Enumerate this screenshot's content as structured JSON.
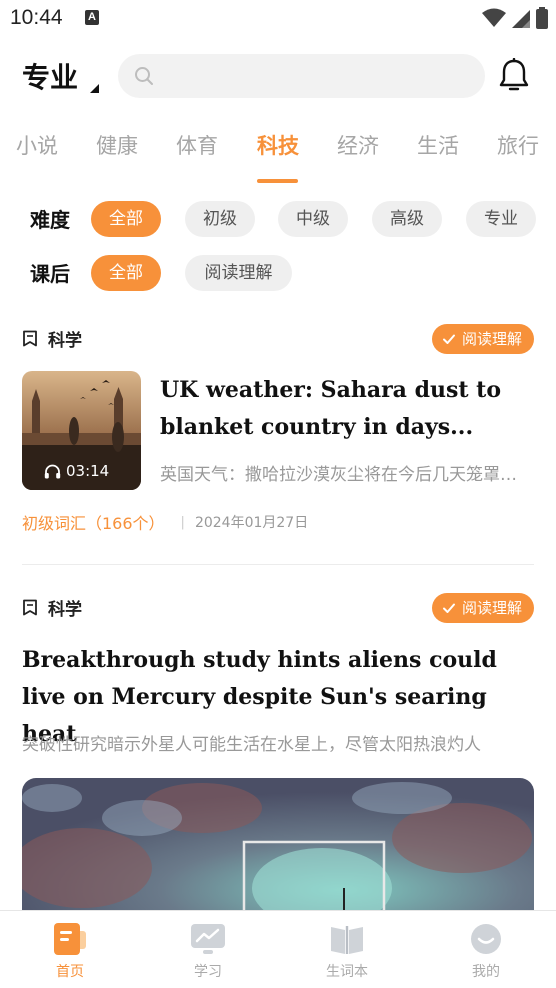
{
  "status_bar": {
    "time": "10:44",
    "app_icon_letter": "A"
  },
  "header": {
    "level": "专业",
    "search": {
      "placeholder": ""
    }
  },
  "categories": {
    "items": [
      "小说",
      "健康",
      "体育",
      "科技",
      "经济",
      "生活",
      "旅行"
    ],
    "active": "科技"
  },
  "filters": {
    "difficulty": {
      "label": "难度",
      "options": [
        "全部",
        "初级",
        "中级",
        "高级",
        "专业"
      ],
      "selected": "全部"
    },
    "after_class": {
      "label": "课后",
      "options": [
        "全部",
        "阅读理解"
      ],
      "selected": "全部"
    }
  },
  "articles": [
    {
      "tag": "科学",
      "badge": "阅读理解",
      "title": "UK weather: Sahara dust to blanket country in days...",
      "subtitle": "英国天气：撒哈拉沙漠灰尘将在今后几天笼罩全国",
      "duration": "03:14",
      "vocab": "初级词汇（166个）",
      "separator": "|",
      "date": "2024年01月27日"
    },
    {
      "tag": "科学",
      "badge": "阅读理解",
      "title": "Breakthrough study hints aliens could live on Mercury despite Sun's searing heat",
      "subtitle": "突破性研究暗示外星人可能生活在水星上，尽管太阳热浪灼人"
    }
  ],
  "bottom_nav": {
    "items": [
      {
        "label": "首页",
        "icon": "home-book-icon",
        "active": true
      },
      {
        "label": "学习",
        "icon": "study-chart-icon",
        "active": false
      },
      {
        "label": "生词本",
        "icon": "vocab-book-icon",
        "active": false
      },
      {
        "label": "我的",
        "icon": "profile-face-icon",
        "active": false
      }
    ]
  },
  "colors": {
    "accent": "#f7913a",
    "chip_bg": "#efefef",
    "muted_text": "#999999",
    "tab_inactive": "#a6a6a6"
  }
}
